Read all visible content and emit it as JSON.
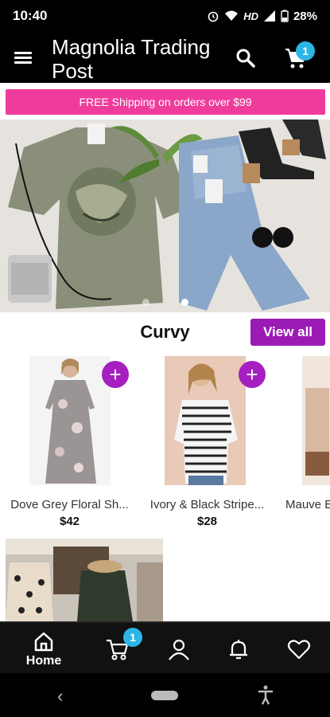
{
  "status": {
    "time": "10:40",
    "network": "HD",
    "battery": "28%"
  },
  "header": {
    "title": "Magnolia Trading Post",
    "cart_count": "1"
  },
  "promo": {
    "text": "FREE Shipping on orders over $99"
  },
  "hero": {
    "slides": 2,
    "active_slide": 2
  },
  "section": {
    "title": "Curvy",
    "view_all": "View all"
  },
  "products": [
    {
      "name": "Dove Grey Floral Sh...",
      "price": "$42"
    },
    {
      "name": "Ivory & Black Stripe...",
      "price": "$28"
    },
    {
      "name": "Mauve E",
      "price": ""
    }
  ],
  "bottom_nav": {
    "home_label": "Home",
    "cart_count": "1",
    "items": [
      "home-icon",
      "cart-icon",
      "account-icon",
      "bell-icon",
      "heart-icon"
    ]
  },
  "colors": {
    "promo": "#ef3c9c",
    "accent": "#9b1bb5",
    "badge": "#2bb6e6"
  }
}
